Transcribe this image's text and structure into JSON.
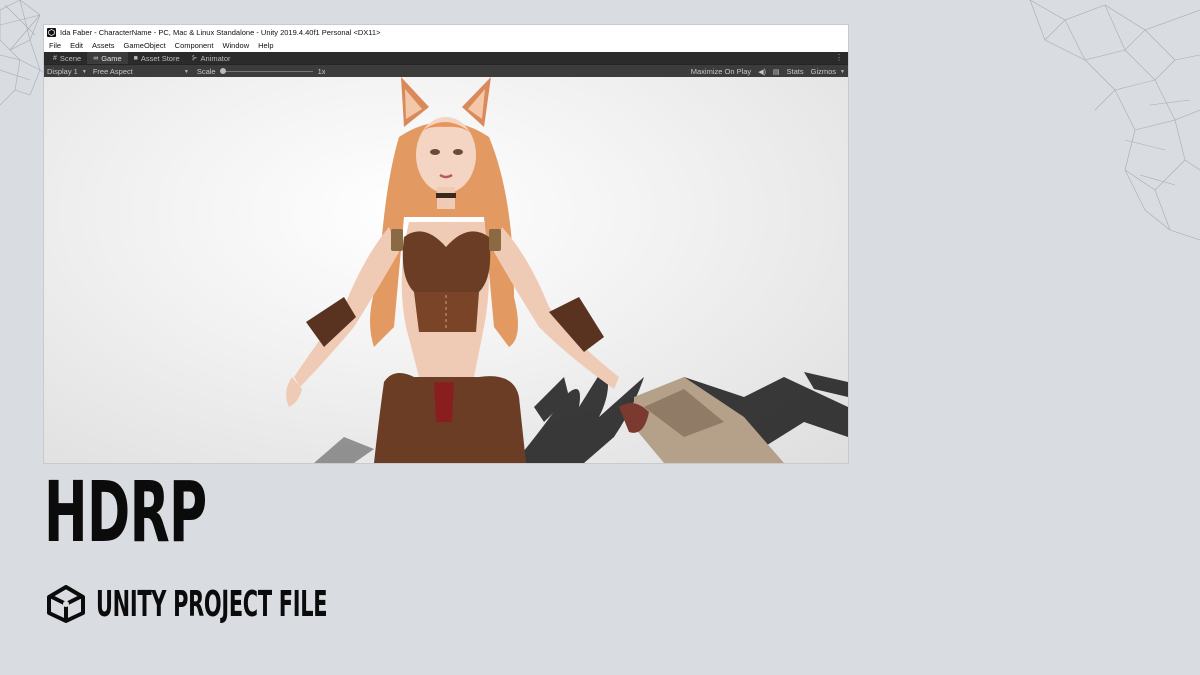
{
  "window": {
    "title": "Ida Faber - CharacterName - PC, Mac & Linux Standalone - Unity 2019.4.40f1 Personal <DX11>"
  },
  "menu": [
    "File",
    "Edit",
    "Assets",
    "GameObject",
    "Component",
    "Window",
    "Help"
  ],
  "tabs": [
    {
      "label": "Scene",
      "icon": "scene-icon",
      "active": false
    },
    {
      "label": "Game",
      "icon": "game-icon",
      "active": true
    },
    {
      "label": "Asset Store",
      "icon": "store-icon",
      "active": false
    },
    {
      "label": "Animator",
      "icon": "animator-icon",
      "active": false
    }
  ],
  "toolbar": {
    "display": "Display 1",
    "aspect": "Free Aspect",
    "scale_label": "Scale",
    "scale_value": "1x",
    "maximize": "Maximize On Play",
    "stats": "Stats",
    "gizmos": "Gizmos"
  },
  "viewport": {
    "description_icon": "character-render"
  },
  "headline": "HDRP",
  "subtitle": "UNITY PROJECT FILE",
  "colors": {
    "background": "#d9dce1",
    "editor_dark": "#3c3c3c",
    "tab_bar": "#2b2b2b",
    "hair": "#e39a62",
    "leather": "#6b3d24",
    "text": "#0b0b0b"
  }
}
